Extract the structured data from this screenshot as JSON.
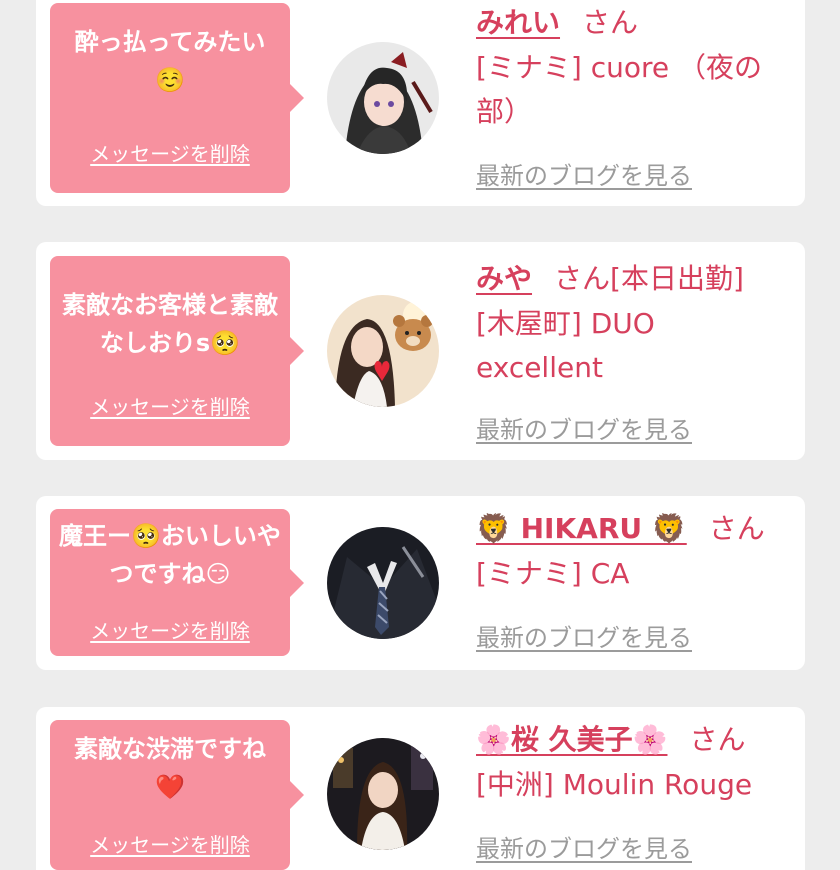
{
  "colors": {
    "bubble": "#f7919f",
    "name": "#d6405d",
    "blog_link": "#9b9b9b",
    "background": "#ededed"
  },
  "messages": [
    {
      "message": "酔っ払ってみたい\n☺️",
      "delete_label": "メッセージを削除",
      "name": "みれい",
      "honorific": "さん",
      "shop": "[ミナミ] cuore （夜の部）",
      "blog_label": "最新のブログを見る",
      "avatar": "anime-girl-avatar"
    },
    {
      "message": "素敵なお客様と素敵なしおりs🥺",
      "delete_label": "メッセージを削除",
      "name": "みや",
      "honorific": "さん[本日出勤]",
      "shop": "[木屋町] DUO excellent",
      "blog_label": "最新のブログを見る",
      "avatar": "woman-with-bear-avatar"
    },
    {
      "message": "魔王ー🥺おいしいやつですね😏",
      "delete_label": "メッセージを削除",
      "name": "🦁 HIKARU 🦁",
      "honorific": "さん",
      "shop": "[ミナミ] CA",
      "blog_label": "最新のブログを見る",
      "avatar": "man-in-suit-avatar"
    },
    {
      "message": "素敵な渋滞ですね\n❤️",
      "delete_label": "メッセージを削除",
      "name": "🌸桜 久美子🌸",
      "honorific": "さん",
      "shop": "[中洲] Moulin Rouge",
      "blog_label": "最新のブログを見る",
      "avatar": "woman-in-bar-avatar"
    }
  ]
}
